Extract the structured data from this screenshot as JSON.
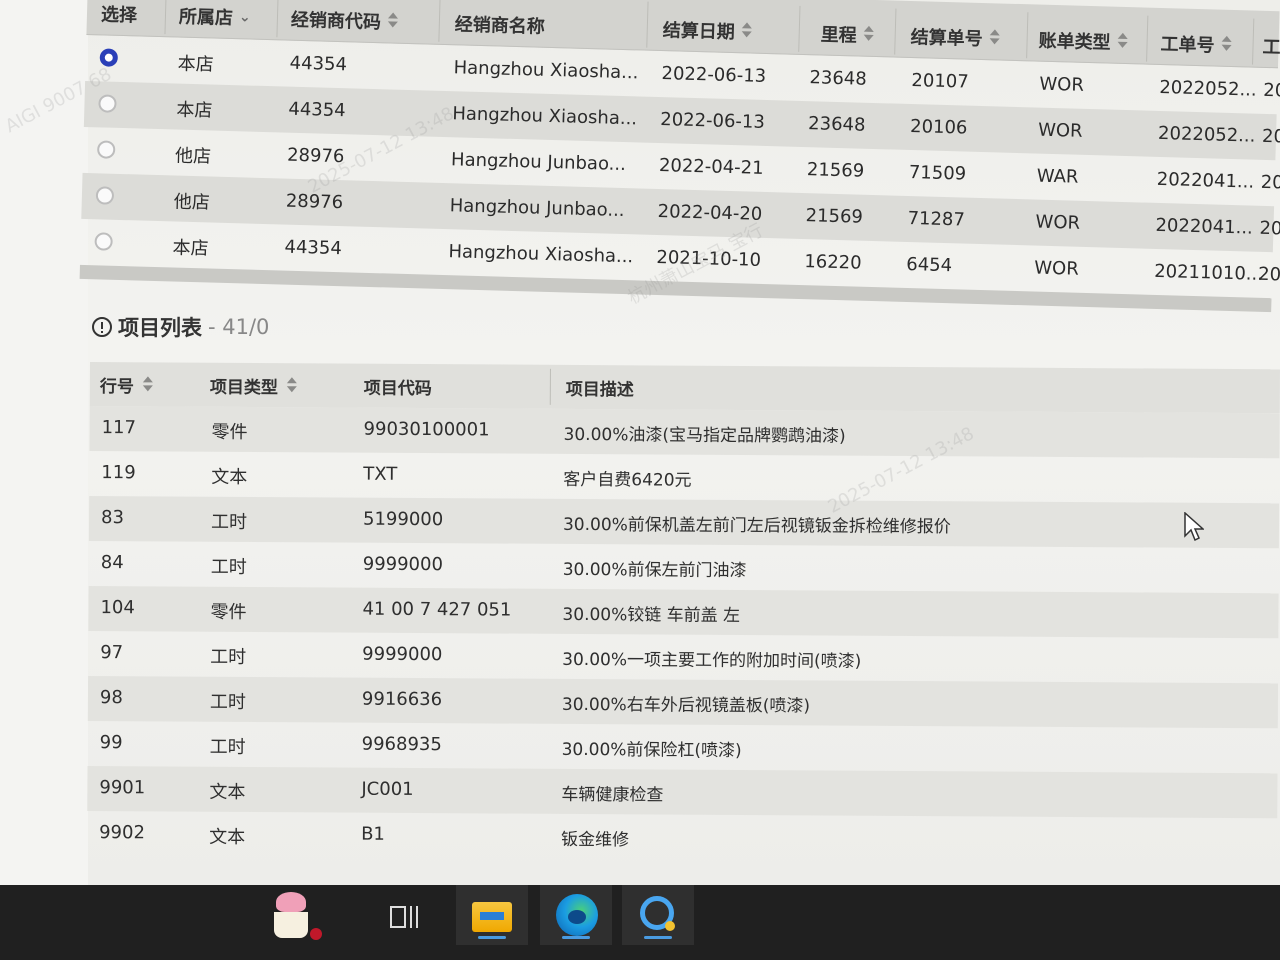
{
  "top_table": {
    "headers": [
      "选择",
      "所属店",
      "经销商代码",
      "经销商名称",
      "结算日期",
      "里程",
      "结算单号",
      "账单类型",
      "工单号",
      "工"
    ],
    "rows": [
      {
        "selected": true,
        "store": "本店",
        "dealer_code": "44354",
        "dealer_name": "Hangzhou Xiaosha...",
        "date": "2022-06-13",
        "mileage": "23648",
        "settle_no": "20107",
        "bill_type": "WOR",
        "order_no": "2022052...",
        "extra": "20"
      },
      {
        "selected": false,
        "store": "本店",
        "dealer_code": "44354",
        "dealer_name": "Hangzhou Xiaosha...",
        "date": "2022-06-13",
        "mileage": "23648",
        "settle_no": "20106",
        "bill_type": "WOR",
        "order_no": "2022052...",
        "extra": "20"
      },
      {
        "selected": false,
        "store": "他店",
        "dealer_code": "28976",
        "dealer_name": "Hangzhou Junbao...",
        "date": "2022-04-21",
        "mileage": "21569",
        "settle_no": "71509",
        "bill_type": "WAR",
        "order_no": "2022041...",
        "extra": "20"
      },
      {
        "selected": false,
        "store": "他店",
        "dealer_code": "28976",
        "dealer_name": "Hangzhou Junbao...",
        "date": "2022-04-20",
        "mileage": "21569",
        "settle_no": "71287",
        "bill_type": "WOR",
        "order_no": "2022041...",
        "extra": "20"
      },
      {
        "selected": false,
        "store": "本店",
        "dealer_code": "44354",
        "dealer_name": "Hangzhou Xiaosha...",
        "date": "2021-10-10",
        "mileage": "16220",
        "settle_no": "6454",
        "bill_type": "WOR",
        "order_no": "20211010...",
        "extra": "20"
      }
    ]
  },
  "items_section": {
    "title": "项目列表",
    "count": "- 41/0",
    "headers": [
      "行号",
      "项目类型",
      "项目代码",
      "项目描述"
    ],
    "rows": [
      {
        "line": "117",
        "type": "零件",
        "code": "99030100001",
        "desc": "30.00%油漆(宝马指定品牌鹦鹉油漆)"
      },
      {
        "line": "119",
        "type": "文本",
        "code": "TXT",
        "desc": "客户自费6420元"
      },
      {
        "line": "83",
        "type": "工时",
        "code": "5199000",
        "desc": "30.00%前保机盖左前门左后视镜钣金拆检维修报价"
      },
      {
        "line": "84",
        "type": "工时",
        "code": "9999000",
        "desc": "30.00%前保左前门油漆"
      },
      {
        "line": "104",
        "type": "零件",
        "code": "41 00 7 427 051",
        "desc": "30.00%铰链 车前盖 左"
      },
      {
        "line": "97",
        "type": "工时",
        "code": "9999000",
        "desc": "30.00%一项主要工作的附加时间(喷漆)"
      },
      {
        "line": "98",
        "type": "工时",
        "code": "9916636",
        "desc": "30.00%右车外后视镜盖板(喷漆)"
      },
      {
        "line": "99",
        "type": "工时",
        "code": "9968935",
        "desc": "30.00%前保险杠(喷漆)"
      },
      {
        "line": "9901",
        "type": "文本",
        "code": "JC001",
        "desc": "车辆健康检查"
      },
      {
        "line": "9902",
        "type": "文本",
        "code": "B1",
        "desc": "钣金维修"
      }
    ]
  },
  "watermark": {
    "lines": [
      "AIGI 9007 68",
      "2025-07-12 13:48",
      "杭州萧山宝马 宝行",
      "2025-07-12 13:48"
    ]
  },
  "taskbar": {
    "icons": [
      "cake-app-icon",
      "task-view-icon",
      "file-explorer-icon",
      "edge-browser-icon",
      "search-app-icon"
    ]
  }
}
